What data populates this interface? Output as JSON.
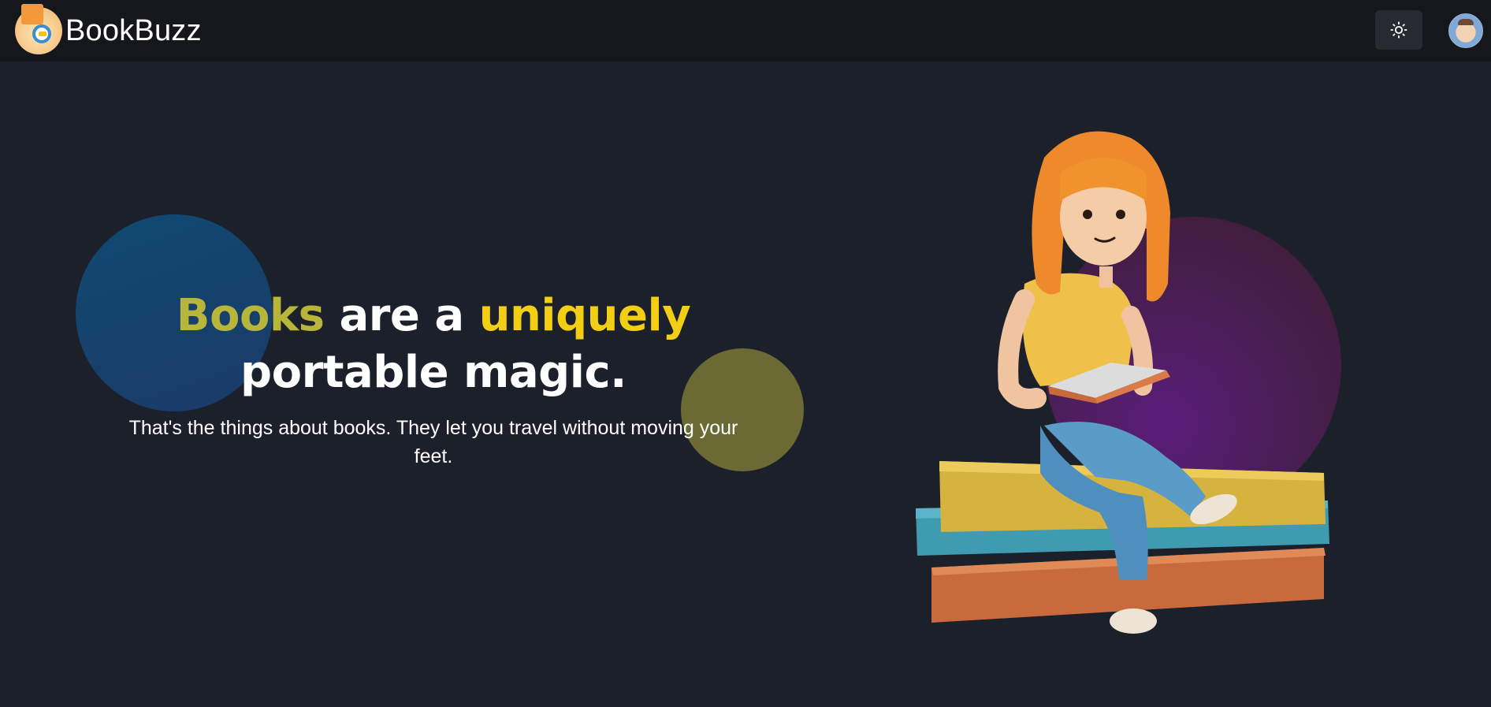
{
  "navbar": {
    "brand_name": "BookBuzz",
    "logo_icon": "book-magnifier-logo",
    "theme_toggle_icon": "sun-icon",
    "avatar_icon": "user-avatar"
  },
  "hero": {
    "headline_word_1": "Books",
    "headline_word_2": " are a ",
    "headline_word_3": "uniquely",
    "headline_line_2": "portable magic.",
    "subtext": "That's the things about books. They let you travel without moving your feet.",
    "illustration_icon": "girl-reading-on-books"
  },
  "colors": {
    "background": "#1c202b",
    "navbar": "#15171c",
    "accent_yellow": "#f2cf14",
    "muted_yellow": "#b8b63a",
    "blob_blue": "#0f4a73",
    "blob_yellow": "#6b6a35",
    "blob_purple": "#5a1d7a"
  }
}
